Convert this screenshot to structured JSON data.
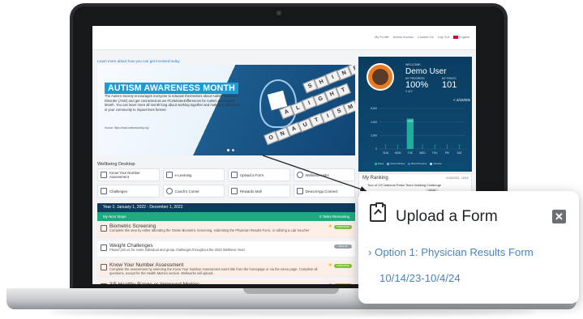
{
  "topnav": {
    "links": [
      "My Profile",
      "Admin Access",
      "Contact Us",
      "Log Out",
      "English"
    ]
  },
  "banner": {
    "get_involved": "Learn more about how you can get involved today",
    "title": "AUTISM AWARENESS MONTH",
    "text": "The Autism Society encourages everyone to educate themselves about Autism Spectrum Disorder (ASD) and get connected as we #CelebrateDifferences for Autism Awareness Month. You can learn more all month long about working together and making a difference in your community to impact lives forever.",
    "source": "Source: https://www.autismsociety.org/",
    "tiles": [
      "S",
      "H",
      "I",
      "N",
      "E",
      "A",
      "L",
      "I",
      "G",
      "H",
      "T",
      "O",
      "N",
      "A",
      "U",
      "T",
      "I",
      "S",
      "M"
    ]
  },
  "desktop": {
    "title": "Wellbeing Desktop",
    "actions": [
      {
        "label": "Know Your Number Assessment",
        "icon": "chart-icon"
      },
      {
        "label": "e-Learning",
        "icon": "laptop-icon"
      },
      {
        "label": "Upload a Form",
        "icon": "upload-icon"
      },
      {
        "label": "Wellness Links",
        "icon": "globe-icon"
      },
      {
        "label": "Challenges",
        "icon": "trophy-icon"
      },
      {
        "label": "Coach's Corner",
        "icon": "coach-icon"
      },
      {
        "label": "Rewards Mall",
        "icon": "cart-icon"
      },
      {
        "label": "Device/App Connect",
        "icon": "device-icon"
      }
    ]
  },
  "year": {
    "label": "Year 1: January 1, 2022 - December 1, 2022"
  },
  "steps": {
    "header": "My Next Steps",
    "remaining": "0 Tasks Remaining",
    "items": [
      {
        "title": "Biometric Screening",
        "desc": "Complete this step by either attending the Onsite Biometric Screening, submitting the Physician Results Form, or utilizing a Lab Voucher",
        "status": "COMPLETED",
        "status_color": "#7bbf3c",
        "bg": "#fdeee6",
        "starred": true
      },
      {
        "title": "Weight Challenges",
        "desc": "Please join us for some individual and group challenges throughout the 2022 Wellness Year!",
        "status": "SIGN UP",
        "status_color": "#9aa3ad",
        "bg": "#ffffff",
        "starred": false
      },
      {
        "title": "Know Your Number Assessment",
        "desc": "Complete the assessment by selecting the Know Your Number Assessment event title from the homepage or via the menu page. Complete all questions, except for the Health Metrics section. Wellworks will upload...",
        "status": "COMPLETED",
        "status_color": "#7bbf3c",
        "bg": "#fdeee6",
        "starred": true
      },
      {
        "title": "3/5 Healthy Range or Improved Metrics",
        "desc": "Once you have completed the Biometric Physical Screening requirement, your results from the screening will be used to determine healthy ranges or if you have improved your metrics. Please Note: You cannot...",
        "status": "IN PROGRESS",
        "status_color": "#f2a31b",
        "bg": "#fdeee6",
        "starred": true
      }
    ]
  },
  "profile": {
    "welcome": "WELCOME,",
    "name": "Demo User",
    "progress_label": "MY PROGRESS",
    "progress_value": "100%",
    "progress_sub": "2 of 2",
    "points_label": "MY POINTS",
    "points_value": "101",
    "date_nav": "< 4/10/202",
    "legend": [
      "Steps",
      "Active Minutes",
      "Blood Pressure",
      "Glucose"
    ],
    "legend_colors": [
      "#1fae9b",
      "#5aa7e6",
      "#2c7bd6",
      "#8fd3ff"
    ]
  },
  "chart_data": {
    "type": "bar",
    "categories": [
      "SUN",
      "MON",
      "TUE",
      "WED",
      "THU",
      "FRI",
      "SAT"
    ],
    "values": [
      0,
      0,
      4500,
      0,
      0,
      0,
      0
    ],
    "ytick_labels": [
      "6,000",
      "4,000",
      "2,000",
      "0"
    ],
    "ylim": [
      0,
      6000
    ],
    "data_label": "4,500"
  },
  "ranking": {
    "title": "My Ranking",
    "dates": "01/01/2022 - 12/31/",
    "challenge": "Tour of US National Parks Team Walking Challenge",
    "button": "Details"
  },
  "callout": {
    "title": "Upload a Form",
    "close": "✕",
    "option": "› Option 1: Physician Results Form",
    "dates": "10/14/23-10/4/24"
  }
}
